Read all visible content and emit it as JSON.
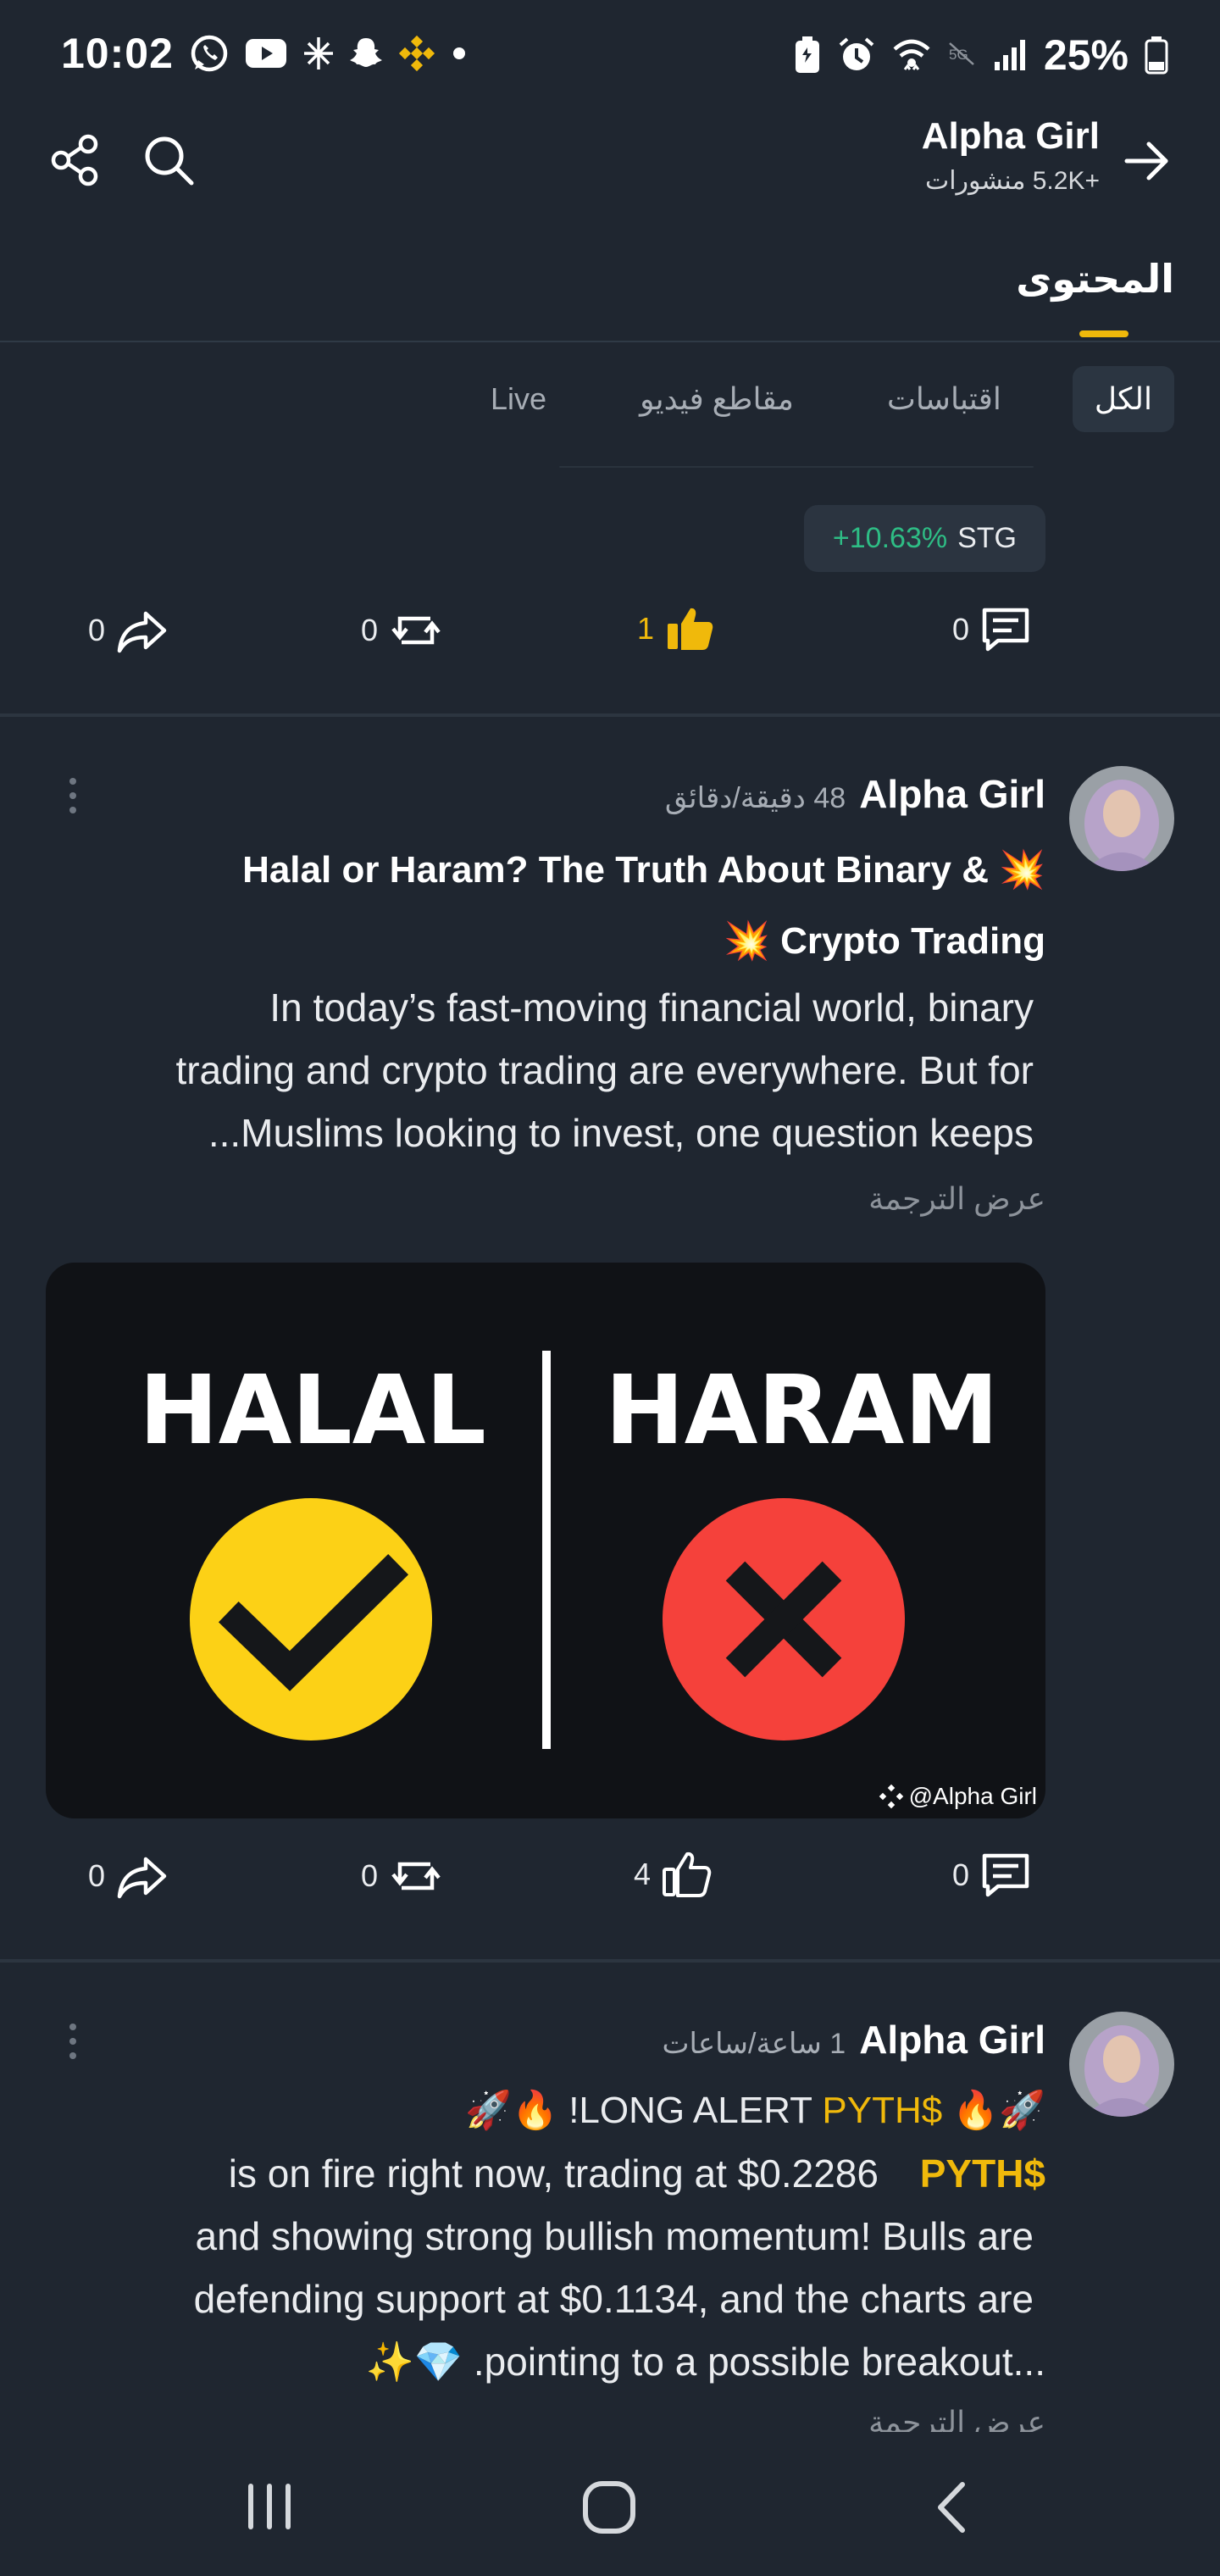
{
  "status_bar": {
    "time": "10:02",
    "battery": "25%",
    "icons": [
      "whatsapp-icon",
      "youtube-icon",
      "snowflake-icon",
      "snapchat-icon",
      "binance-icon",
      "dot-icon",
      "battery-saver-icon",
      "alarm-icon",
      "wifi-icon",
      "no-5g-icon",
      "signal-icon",
      "battery-icon"
    ]
  },
  "header": {
    "profile_name": "Alpha Girl",
    "posts_count": "+5.2K منشورات",
    "content_tab": "المحتوى"
  },
  "filters": {
    "items": [
      {
        "label": "الكل",
        "active": true
      },
      {
        "label": "اقتباسات",
        "active": false
      },
      {
        "label": "مقاطع فيديو",
        "active": false
      },
      {
        "label": "Live",
        "active": false
      }
    ]
  },
  "prev_post": {
    "ticker_symbol": "STG",
    "ticker_change": "+10.63%",
    "actions": {
      "comments": "0",
      "likes": "1",
      "reposts": "0",
      "shares": "0"
    }
  },
  "posts": [
    {
      "author": "Alpha Girl",
      "time": "48 دقيقة/دقائق",
      "title_line1": "Halal or Haram? The Truth About Binary & 💥",
      "title_line2": "💥 Crypto Trading",
      "body_line1": "In today’s fast-moving financial world, binary",
      "body_line2": "trading and crypto trading are everywhere. But for",
      "body_line3": "...Muslims looking to invest, one question keeps",
      "translate": "عرض الترجمة",
      "image": {
        "halal": "HALAL",
        "haram": "HARAM",
        "watermark": "@Alpha Girl",
        "colors": {
          "halal_circle": "#fcd116",
          "haram_circle": "#f5413b"
        }
      },
      "actions": {
        "comments": "0",
        "likes": "4",
        "reposts": "0",
        "shares": "0"
      }
    },
    {
      "author": "Alpha Girl",
      "time": "1 ساعة/ساعات",
      "line1_pre": "🚀🔥 !LONG ALERT ",
      "line1_ticker": "PYTH$",
      "line1_post": " 🔥🚀",
      "line2_text": "is on fire right now, trading at $0.2286",
      "line2_ticker": "PYTH$",
      "line3": "and showing strong bullish momentum! Bulls are",
      "line4": "defending support at $0.1134, and the charts are",
      "line5": "✨💎 .pointing to a possible breakout...",
      "translate": "عرض الترجمة"
    }
  ],
  "colors": {
    "background": "#1f2630",
    "accent": "#f0b90b",
    "positive": "#2ebd85"
  }
}
